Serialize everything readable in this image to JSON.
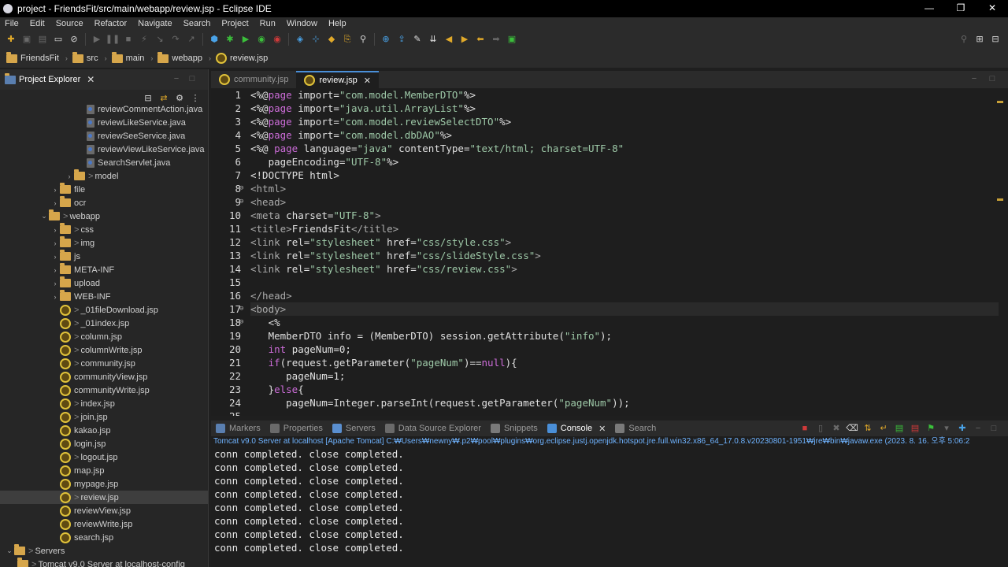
{
  "window": {
    "title": "project - FriendsFit/src/main/webapp/review.jsp - Eclipse IDE",
    "minimize": "—",
    "maximize": "❐",
    "close": "✕"
  },
  "menu": [
    "File",
    "Edit",
    "Source",
    "Refactor",
    "Navigate",
    "Search",
    "Project",
    "Run",
    "Window",
    "Help"
  ],
  "breadcrumb": [
    {
      "label": "FriendsFit",
      "icon": "project-icon"
    },
    {
      "label": "src",
      "icon": "folder-icon"
    },
    {
      "label": "main",
      "icon": "folder-icon"
    },
    {
      "label": "webapp",
      "icon": "folder-icon"
    },
    {
      "label": "review.jsp",
      "icon": "jsp-file-icon"
    }
  ],
  "explorer": {
    "title": "Project Explorer",
    "items": [
      {
        "label": "reviewCommentAction.java",
        "type": "java",
        "indent": 110
      },
      {
        "label": "reviewLikeService.java",
        "type": "java",
        "indent": 110
      },
      {
        "label": "reviewSeeService.java",
        "type": "java",
        "indent": 110
      },
      {
        "label": "reviewViewLikeService.java",
        "type": "java",
        "indent": 110
      },
      {
        "label": "SearchServlet.java",
        "type": "java",
        "indent": 110
      },
      {
        "label": "model",
        "type": "package",
        "indent": 82,
        "twisty": ">",
        "gt": true
      },
      {
        "label": "file",
        "type": "folder",
        "indent": 64,
        "twisty": ">"
      },
      {
        "label": "ocr",
        "type": "folder",
        "indent": 64,
        "twisty": ">"
      },
      {
        "label": "webapp",
        "type": "folder",
        "indent": 50,
        "twisty": "v",
        "gt": true
      },
      {
        "label": "css",
        "type": "folder",
        "indent": 64,
        "twisty": ">",
        "gt": true
      },
      {
        "label": "img",
        "type": "folder",
        "indent": 64,
        "twisty": ">",
        "gt": true
      },
      {
        "label": "js",
        "type": "folder",
        "indent": 64,
        "twisty": ">"
      },
      {
        "label": "META-INF",
        "type": "folder",
        "indent": 64,
        "twisty": ">"
      },
      {
        "label": "upload",
        "type": "folder",
        "indent": 64,
        "twisty": ">"
      },
      {
        "label": "WEB-INF",
        "type": "folder",
        "indent": 64,
        "twisty": ">"
      },
      {
        "label": "_01fileDownload.jsp",
        "type": "jsp",
        "indent": 76,
        "gt": true
      },
      {
        "label": "_01index.jsp",
        "type": "jsp",
        "indent": 76,
        "gt": true
      },
      {
        "label": "column.jsp",
        "type": "jsp",
        "indent": 76,
        "gt": true
      },
      {
        "label": "columnWrite.jsp",
        "type": "jsp",
        "indent": 76,
        "gt": true
      },
      {
        "label": "community.jsp",
        "type": "jsp",
        "indent": 76,
        "gt": true
      },
      {
        "label": "communityView.jsp",
        "type": "jsp",
        "indent": 76
      },
      {
        "label": "communityWrite.jsp",
        "type": "jsp",
        "indent": 76
      },
      {
        "label": "index.jsp",
        "type": "jsp",
        "indent": 76,
        "gt": true
      },
      {
        "label": "join.jsp",
        "type": "jsp",
        "indent": 76,
        "gt": true
      },
      {
        "label": "kakao.jsp",
        "type": "jsp",
        "indent": 76
      },
      {
        "label": "login.jsp",
        "type": "jsp",
        "indent": 76
      },
      {
        "label": "logout.jsp",
        "type": "jsp",
        "indent": 76,
        "gt": true
      },
      {
        "label": "map.jsp",
        "type": "jsp",
        "indent": 76
      },
      {
        "label": "mypage.jsp",
        "type": "jsp",
        "indent": 76
      },
      {
        "label": "review.jsp",
        "type": "jsp",
        "indent": 76,
        "gt": true,
        "selected": true
      },
      {
        "label": "reviewView.jsp",
        "type": "jsp",
        "indent": 76
      },
      {
        "label": "reviewWrite.jsp",
        "type": "jsp",
        "indent": 76
      },
      {
        "label": "search.jsp",
        "type": "jsp",
        "indent": 76
      },
      {
        "label": "Servers",
        "type": "folder",
        "indent": 6,
        "twisty": "v",
        "gt": true
      },
      {
        "label": "Tomcat v9.0 Server at localhost-config",
        "type": "folder",
        "indent": 22,
        "gt": true
      }
    ]
  },
  "editor": {
    "tabs": [
      {
        "label": "community.jsp",
        "active": false
      },
      {
        "label": "review.jsp",
        "active": true
      }
    ],
    "current_line": 17,
    "lines": [
      {
        "n": "1",
        "html": "<span class='t'>&lt;%@</span><span class='k'>page</span> <span class='t'>import=</span><span class='str'>\"com.model.MemberDTO\"</span><span class='t'>%&gt;</span>"
      },
      {
        "n": "2",
        "html": "<span class='t'>&lt;%@</span><span class='k'>page</span> <span class='t'>import=</span><span class='str'>\"java.util.ArrayList\"</span><span class='t'>%&gt;</span>"
      },
      {
        "n": "3",
        "html": "<span class='t'>&lt;%@</span><span class='k'>page</span> <span class='t'>import=</span><span class='str'>\"com.model.reviewSelectDTO\"</span><span class='t'>%&gt;</span>"
      },
      {
        "n": "4",
        "html": "<span class='t'>&lt;%@</span><span class='k'>page</span> <span class='t'>import=</span><span class='str'>\"com.model.dbDAO\"</span><span class='t'>%&gt;</span>"
      },
      {
        "n": "5",
        "html": "<span class='t'>&lt;%@ </span><span class='k'>page</span> <span class='t'>language=</span><span class='str'>\"java\"</span> <span class='t'>contentType=</span><span class='str'>\"text/html; charset=UTF-8\"</span>"
      },
      {
        "n": "6",
        "html": "   <span class='t'>pageEncoding=</span><span class='str'>\"UTF-8\"</span><span class='t'>%&gt;</span>"
      },
      {
        "n": "7",
        "html": "<span class='t'>&lt;!DOCTYPE html&gt;</span>"
      },
      {
        "n": "8",
        "fold": "⊖",
        "html": "<span class='tag'>&lt;html&gt;</span>"
      },
      {
        "n": "9",
        "fold": "⊖",
        "html": "<span class='tag'>&lt;head&gt;</span>"
      },
      {
        "n": "10",
        "html": "<span class='tag'>&lt;meta</span> <span class='t'>charset=</span><span class='str'>\"UTF-8\"</span><span class='tag'>&gt;</span>"
      },
      {
        "n": "11",
        "html": "<span class='tag'>&lt;title&gt;</span><span class='t'>FriendsFit</span><span class='tag'>&lt;/title&gt;</span>"
      },
      {
        "n": "12",
        "html": "<span class='tag'>&lt;link</span> <span class='t'>rel=</span><span class='str'>\"stylesheet\"</span> <span class='t'>href=</span><span class='str'>\"css/style.css\"</span><span class='tag'>&gt;</span>"
      },
      {
        "n": "13",
        "html": "<span class='tag'>&lt;link</span> <span class='t'>rel=</span><span class='str'>\"stylesheet\"</span> <span class='t'>href=</span><span class='str'>\"css/slideStyle.css\"</span><span class='tag'>&gt;</span>"
      },
      {
        "n": "14",
        "html": "<span class='tag'>&lt;link</span> <span class='t'>rel=</span><span class='str'>\"stylesheet\"</span> <span class='t'>href=</span><span class='str'>\"css/review.css\"</span><span class='tag'>&gt;</span>"
      },
      {
        "n": "15",
        "html": ""
      },
      {
        "n": "16",
        "html": "<span class='tag'>&lt;/head&gt;</span>"
      },
      {
        "n": "17",
        "fold": "⊖",
        "html": "<span class='tag'>&lt;body&gt;</span>"
      },
      {
        "n": "18",
        "fold": "⊖",
        "html": "   <span class='t'>&lt;%</span>"
      },
      {
        "n": "19",
        "html": "   <span class='t'>MemberDTO info = (MemberDTO) session.getAttribute(</span><span class='str'>\"info\"</span><span class='t'>);</span>"
      },
      {
        "n": "20",
        "html": "   <span class='k'>int</span> <span class='t'>pageNum=0;</span>"
      },
      {
        "n": "21",
        "html": "   <span class='k'>if</span><span class='t'>(request.getParameter(</span><span class='str'>\"pageNum\"</span><span class='t'>)==</span><span class='k'>null</span><span class='t'>){</span>"
      },
      {
        "n": "22",
        "html": "      <span class='t'>pageNum=1;</span>"
      },
      {
        "n": "23",
        "html": "   <span class='t'>}</span><span class='k'>else</span><span class='t'>{</span>"
      },
      {
        "n": "24",
        "html": "      <span class='t'>pageNum=Integer.parseInt(request.getParameter(</span><span class='str'>\"pageNum\"</span><span class='t'>));</span>"
      },
      {
        "n": "25",
        "html": ""
      }
    ]
  },
  "bottom": {
    "tabs": [
      {
        "label": "Markers",
        "active": false,
        "color": "#5a7fb0"
      },
      {
        "label": "Properties",
        "active": false,
        "color": "#6a6a6a"
      },
      {
        "label": "Servers",
        "active": false,
        "color": "#5a8fd0"
      },
      {
        "label": "Data Source Explorer",
        "active": false,
        "color": "#6a6a6a"
      },
      {
        "label": "Snippets",
        "active": false,
        "color": "#7a7a7a"
      },
      {
        "label": "Console",
        "active": true,
        "color": "#4a8fd8"
      },
      {
        "label": "Search",
        "active": false,
        "color": "#7a7a7a"
      }
    ],
    "console_header": "Tomcat v9.0 Server at localhost [Apache Tomcat] C:₩Users₩newny₩.p2₩pool₩plugins₩org.eclipse.justj.openjdk.hotspot.jre.full.win32.x86_64_17.0.8.v20230801-1951₩jre₩bin₩javaw.exe  (2023. 8. 16. 오후 5:06:2",
    "console_lines": [
      "conn completed. close completed.",
      "conn completed. close completed.",
      "conn completed. close completed.",
      "conn completed. close completed.",
      "conn completed. close completed.",
      "conn completed. close completed.",
      "conn completed. close completed.",
      "conn completed. close completed."
    ]
  }
}
